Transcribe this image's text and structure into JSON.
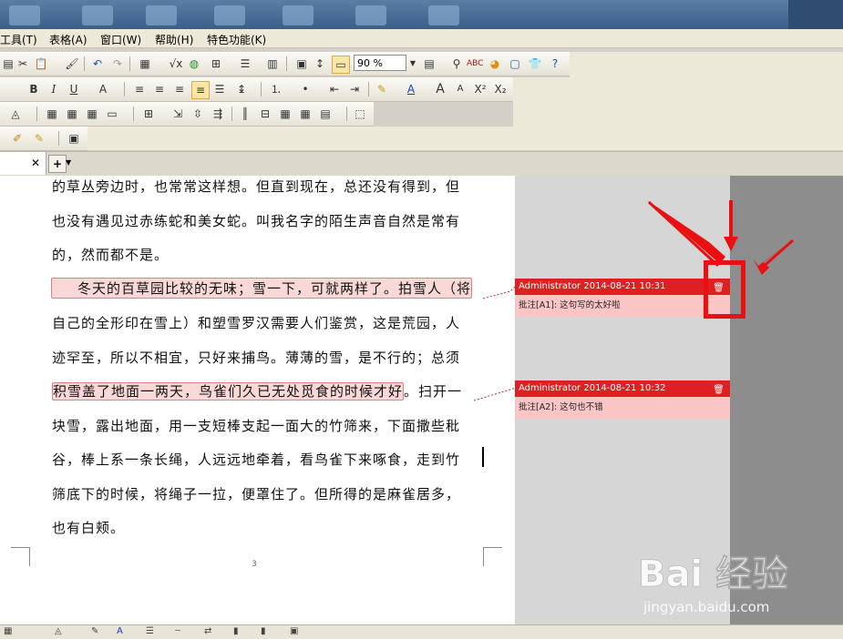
{
  "menubar": {
    "items": [
      "工具(T)",
      "表格(A)",
      "窗口(W)",
      "帮助(H)",
      "特色功能(K)"
    ]
  },
  "toolbar": {
    "zoom": "90 %"
  },
  "document": {
    "lines": [
      "的草丛旁边时，也常常这样想。但直到现在，总还没有得到，但",
      "也没有遇见过赤练蛇和美女蛇。叫我名字的陌生声音自然是常有",
      "的，然而都不是。",
      "冬天的百草园比较的无味；雪一下，可就两样了。拍雪人（将",
      "自己的全形印在雪上）和塑雪罗汉需要人们鉴赏，这是荒园，人",
      "迹罕至，所以不相宜，只好来捕鸟。薄薄的雪，是不行的；总须",
      "积雪盖了地面一两天，鸟雀们久已无处觅食的时候才好",
      "。扫开一",
      "块雪，露出地面，用一支短棒支起一面大的竹筛来，下面撒些秕",
      "谷，棒上系一条长绳，人远远地牵着，看鸟雀下来啄食，走到竹",
      "筛底下的时候，将绳子一拉，便罩住了。但所得的是麻雀居多，",
      "也有白颊。"
    ],
    "page_number": "3"
  },
  "comments": [
    {
      "header": "Administrator 2014-08-21 10:31",
      "body": "批注[A1]: 这句写的太好啦"
    },
    {
      "header": "Administrator 2014-08-21 10:32",
      "body": "批注[A2]: 这句也不错"
    }
  ],
  "icons": {
    "delete": "trash-icon",
    "tab_close": "close-icon",
    "add_tab": "plus-icon"
  },
  "colors": {
    "comment_header": "#e02020",
    "comment_body": "#fbc5c5",
    "highlight": "#fbd8d8",
    "annotation_arrow": "#e81010"
  },
  "watermark": {
    "brand": "Bai 经验",
    "url": "jingyan.baidu.com"
  }
}
